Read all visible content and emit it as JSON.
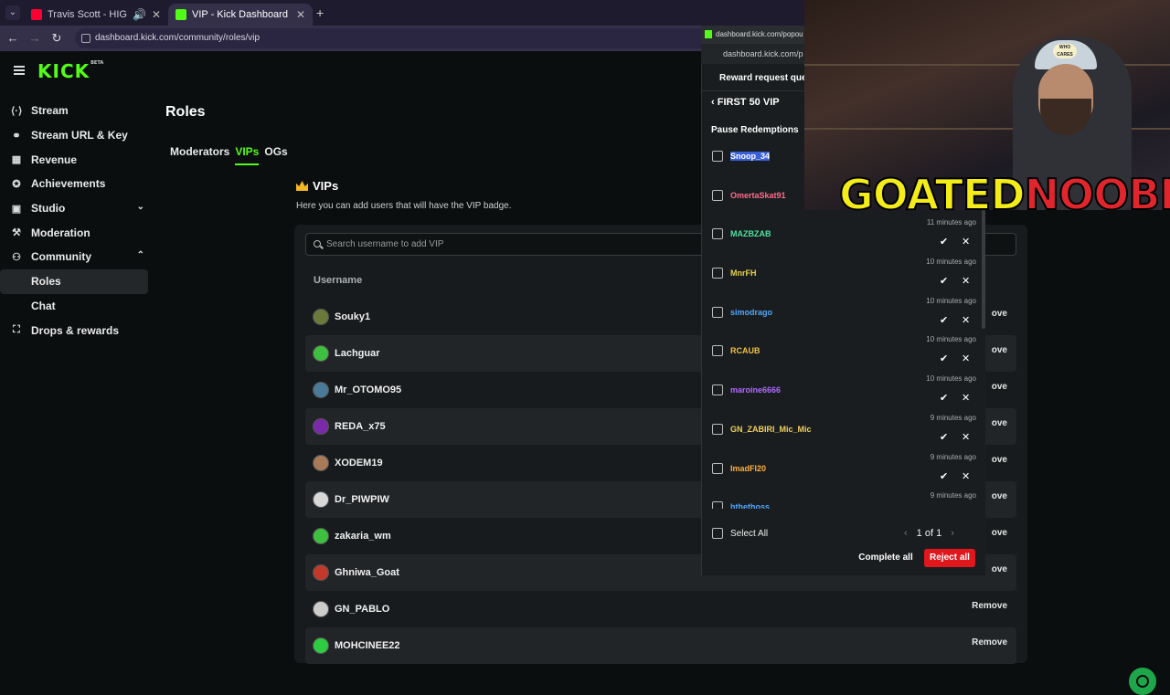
{
  "browser": {
    "tabs": [
      {
        "title": "Travis Scott - HIGHEST IN THE",
        "favicon_color": "#ff0033",
        "active": false
      },
      {
        "title": "VIP - Kick Dashboard",
        "favicon_color": "#53fc18",
        "active": true
      }
    ],
    "new_tab": "+",
    "close_glyph": "✕",
    "url": "dashboard.kick.com/community/roles/vip"
  },
  "logo": {
    "text": "KICK",
    "badge": "BETA"
  },
  "sidebar": {
    "items": [
      {
        "label": "Stream",
        "icon": "stream-icon",
        "glyph": "⟨·⟩"
      },
      {
        "label": "Stream URL & Key",
        "icon": "link-icon",
        "glyph": "⚭"
      },
      {
        "label": "Revenue",
        "icon": "revenue-icon",
        "glyph": "▦"
      },
      {
        "label": "Achievements",
        "icon": "trophy-icon",
        "glyph": "✪"
      },
      {
        "label": "Studio",
        "icon": "studio-icon",
        "glyph": "▣",
        "chevron": "⌄"
      },
      {
        "label": "Moderation",
        "icon": "wrench-icon",
        "glyph": "⚒"
      },
      {
        "label": "Community",
        "icon": "community-icon",
        "glyph": "⚇",
        "chevron": "⌃"
      }
    ],
    "sub_items": [
      "Roles",
      "Chat"
    ],
    "last_item": {
      "label": "Drops & rewards",
      "icon": "drops-icon",
      "glyph": "⛶"
    }
  },
  "main": {
    "title": "Roles",
    "tabs": [
      "Moderators",
      "VIPs",
      "OGs"
    ],
    "section_title": "VIPs",
    "section_desc": "Here you can add users that will have the VIP badge.",
    "search_placeholder": "Search username to add VIP",
    "column_header": "Username",
    "remove_label": "Remove",
    "vips": [
      {
        "name": "Souky1",
        "avatar_color": "#6b7a3a",
        "remove": "ove"
      },
      {
        "name": "Lachguar",
        "avatar_color": "#3fbf3f",
        "remove": "ove"
      },
      {
        "name": "Mr_OTOMO95",
        "avatar_color": "#4a7a9a",
        "remove": "ove"
      },
      {
        "name": "REDA_x75",
        "avatar_color": "#7a2aa8",
        "remove": "ove"
      },
      {
        "name": "XODEM19",
        "avatar_color": "#a87a5a",
        "remove": "ove"
      },
      {
        "name": "Dr_PIWPIW",
        "avatar_color": "#d8d8d8",
        "remove": "ove"
      },
      {
        "name": "zakaria_wm",
        "avatar_color": "#3fbf3f",
        "remove": "ove"
      },
      {
        "name": "Ghniwa_Goat",
        "avatar_color": "#c0392b",
        "remove": "ove"
      },
      {
        "name": "GN_PABLO",
        "avatar_color": "#cccccc",
        "remove": "Remove"
      },
      {
        "name": "MOHCINEE22",
        "avatar_color": "#2ecc40",
        "remove": "Remove"
      }
    ]
  },
  "popup": {
    "url_top": "dashboard.kick.com/popou",
    "url": "dashboard.kick.com/p",
    "header": "Reward request que",
    "reward_title": "FIRST 50 VIP",
    "pause_label": "Pause Redemptions",
    "redemptions": [
      {
        "name": "Snoop_34",
        "color": "#4fa8ff",
        "time": "",
        "selected_text": true
      },
      {
        "name": "OmertaSkat91",
        "color": "#ff6b8a",
        "time": ""
      },
      {
        "name": "MAZBZAB",
        "color": "#4ee0a0",
        "time": "11 minutes ago"
      },
      {
        "name": "MnrFH",
        "color": "#e8d24a",
        "time": "10 minutes ago"
      },
      {
        "name": "simodrago",
        "color": "#4fa8ff",
        "time": "10 minutes ago"
      },
      {
        "name": "RCAUB",
        "color": "#f0c040",
        "time": "10 minutes ago"
      },
      {
        "name": "maroine6666",
        "color": "#b069ff",
        "time": "10 minutes ago"
      },
      {
        "name": "GN_ZABIRI_Mic_Mic",
        "color": "#f0d060",
        "time": "9 minutes ago"
      },
      {
        "name": "ImadFl20",
        "color": "#ffb040",
        "time": "9 minutes ago"
      },
      {
        "name": "hthethoss",
        "color": "#4fa8ff",
        "time": "9 minutes ago"
      }
    ],
    "select_all": "Select All",
    "pager": "1 of 1",
    "complete_all": "Complete all",
    "reject_all": "Reject all"
  },
  "webcam": {
    "overlay_gold": "GOATED",
    "overlay_red": "NOOBIE",
    "cap_badge": "WHO CARES"
  }
}
